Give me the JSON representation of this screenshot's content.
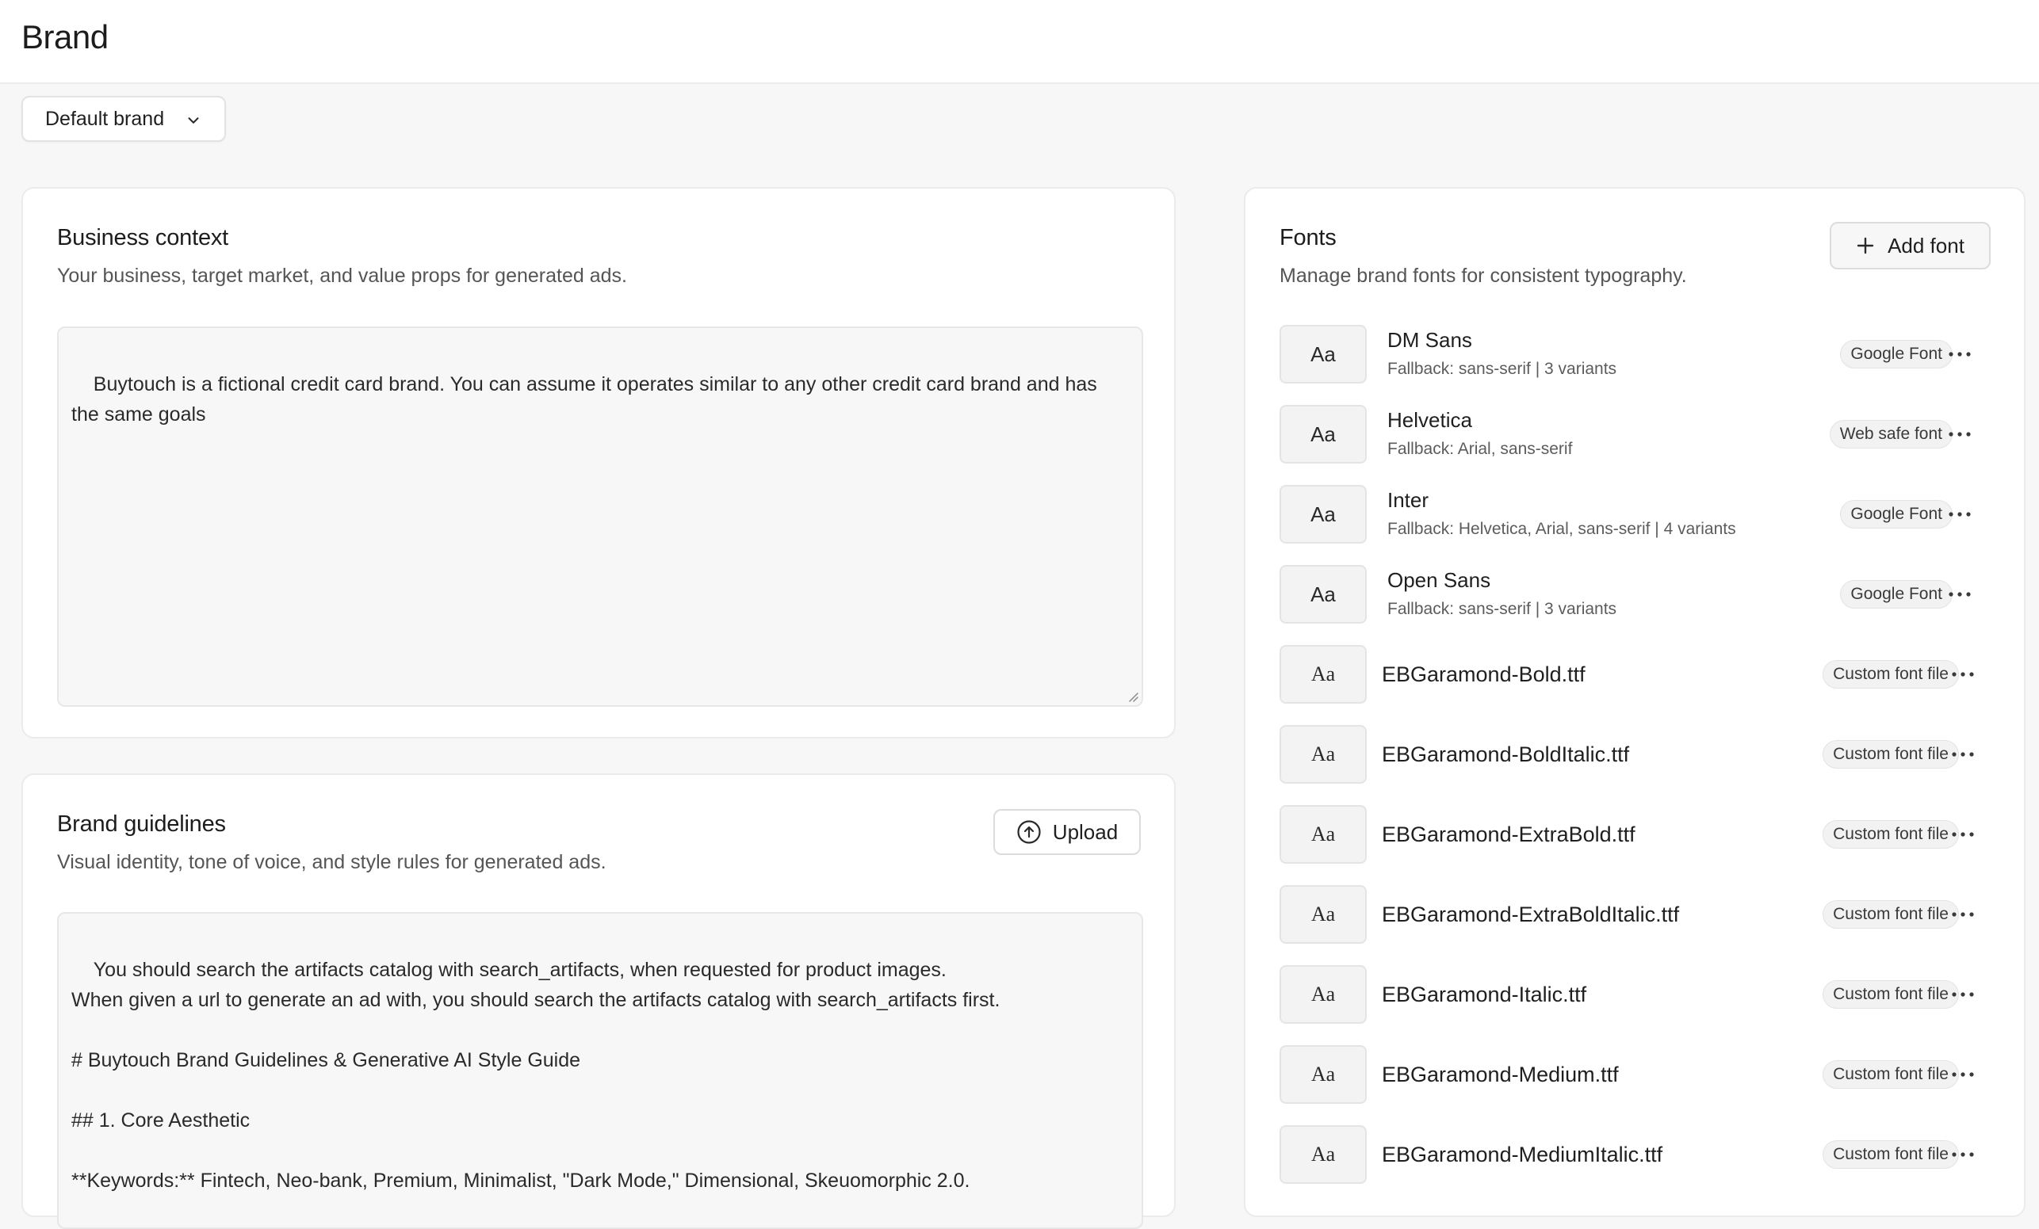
{
  "header": {
    "title": "Brand"
  },
  "brand_selector": {
    "value": "Default brand"
  },
  "business_context": {
    "title": "Business context",
    "subtitle": "Your business, target market, and value props for generated ads.",
    "text": "Buytouch is a fictional credit card brand. You can assume it operates similar to any other credit card brand and has the same goals"
  },
  "brand_guidelines": {
    "title": "Brand guidelines",
    "subtitle": "Visual identity, tone of voice, and style rules for generated ads.",
    "upload_label": "Upload",
    "text": "You should search the artifacts catalog with search_artifacts, when requested for product images.\nWhen given a url to generate an ad with, you should search the artifacts catalog with search_artifacts first.\n\n# Buytouch Brand Guidelines & Generative AI Style Guide\n\n## 1. Core Aesthetic\n\n**Keywords:** Fintech, Neo-bank, Premium, Minimalist, \"Dark Mode,\" Dimensional, Skeuomorphic 2.0."
  },
  "fonts": {
    "title": "Fonts",
    "subtitle": "Manage brand fonts for consistent typography.",
    "add_label": "Add font",
    "preview_text": "Aa",
    "items": [
      {
        "name": "DM Sans",
        "fallback": "Fallback: sans-serif | 3 variants",
        "tag": "Google Font",
        "kind": "google"
      },
      {
        "name": "Helvetica",
        "fallback": "Fallback: Arial, sans-serif",
        "tag": "Web safe font",
        "kind": "websafe"
      },
      {
        "name": "Inter",
        "fallback": "Fallback: Helvetica, Arial, sans-serif | 4 variants",
        "tag": "Google Font",
        "kind": "google"
      },
      {
        "name": "Open Sans",
        "fallback": "Fallback: sans-serif | 3 variants",
        "tag": "Google Font",
        "kind": "google"
      },
      {
        "name": "EBGaramond-Bold.ttf",
        "tag": "Custom font file",
        "kind": "custom"
      },
      {
        "name": "EBGaramond-BoldItalic.ttf",
        "tag": "Custom font file",
        "kind": "custom"
      },
      {
        "name": "EBGaramond-ExtraBold.ttf",
        "tag": "Custom font file",
        "kind": "custom"
      },
      {
        "name": "EBGaramond-ExtraBoldItalic.ttf",
        "tag": "Custom font file",
        "kind": "custom"
      },
      {
        "name": "EBGaramond-Italic.ttf",
        "tag": "Custom font file",
        "kind": "custom"
      },
      {
        "name": "EBGaramond-Medium.ttf",
        "tag": "Custom font file",
        "kind": "custom"
      },
      {
        "name": "EBGaramond-MediumItalic.ttf",
        "tag": "Custom font file",
        "kind": "custom"
      }
    ]
  }
}
